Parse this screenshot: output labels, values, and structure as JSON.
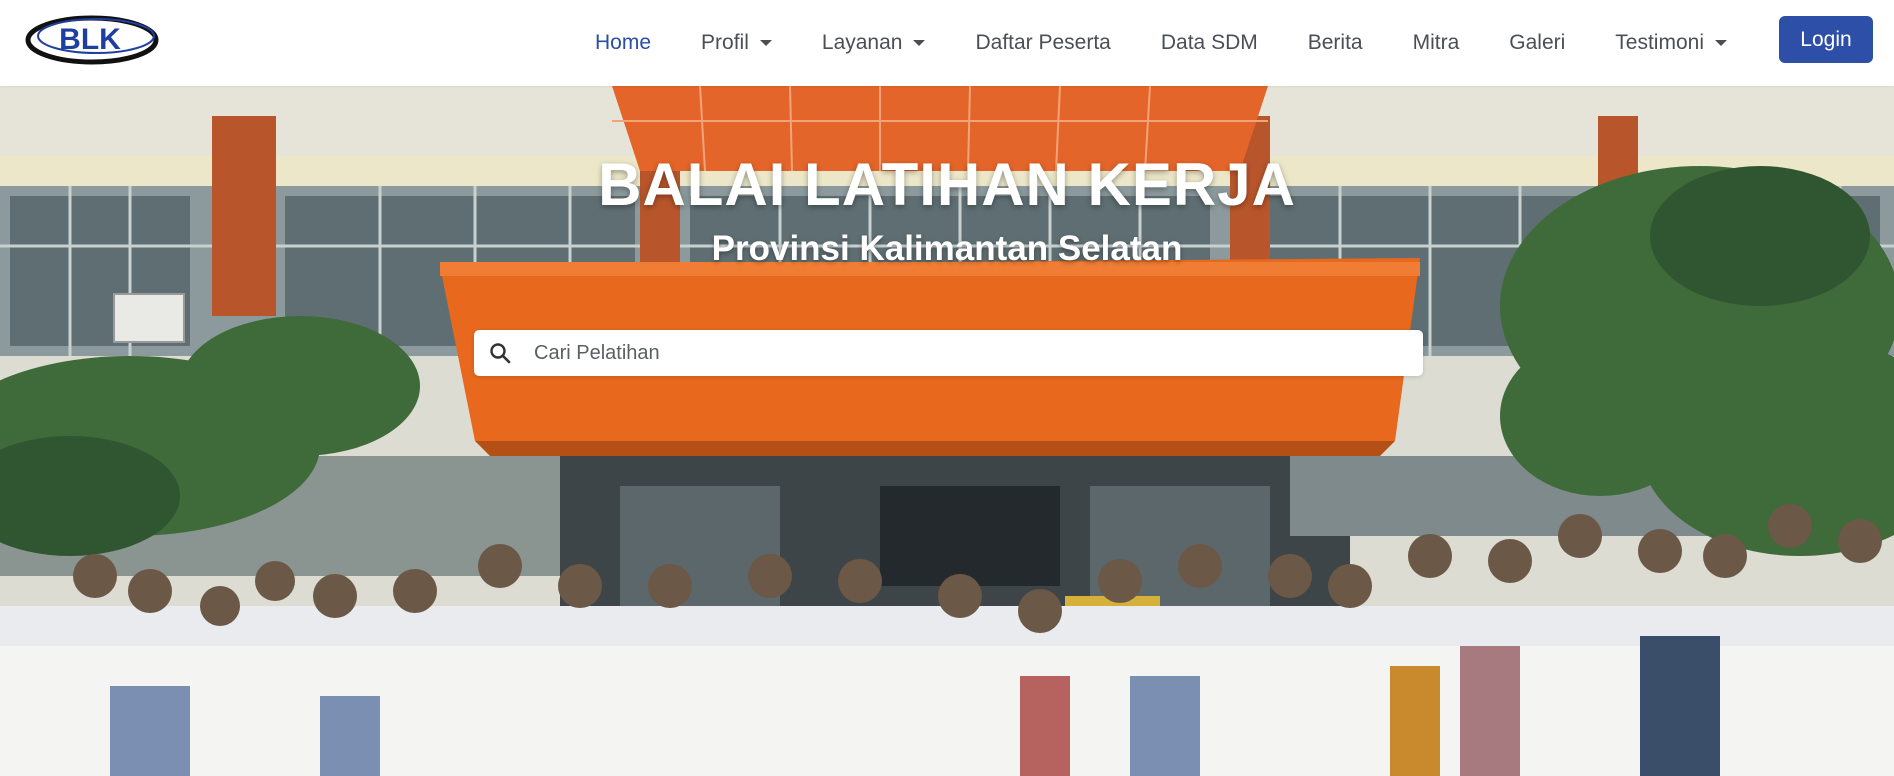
{
  "brand": {
    "logo_text": "BLK",
    "logo_icon": "blk-logo"
  },
  "nav": {
    "items": [
      {
        "label": "Home",
        "active": true,
        "dropdown": false
      },
      {
        "label": "Profil",
        "active": false,
        "dropdown": true
      },
      {
        "label": "Layanan",
        "active": false,
        "dropdown": true
      },
      {
        "label": "Daftar Peserta",
        "active": false,
        "dropdown": false
      },
      {
        "label": "Data SDM",
        "active": false,
        "dropdown": false
      },
      {
        "label": "Berita",
        "active": false,
        "dropdown": false
      },
      {
        "label": "Mitra",
        "active": false,
        "dropdown": false
      },
      {
        "label": "Galeri",
        "active": false,
        "dropdown": false
      },
      {
        "label": "Testimoni",
        "active": false,
        "dropdown": true
      }
    ],
    "login_label": "Login"
  },
  "hero": {
    "title": "BALAI LATIHAN KERJA",
    "subtitle": "Provinsi Kalimantan Selatan",
    "search": {
      "placeholder": "Cari Pelatihan",
      "value": "",
      "icon": "search-icon"
    },
    "image": "group-photo-in-front-of-building"
  },
  "colors": {
    "accent": "#2d4fa8",
    "active_nav": "#2a4ea3",
    "nav_text": "#4b4f55",
    "canopy_orange": "#e86a1c"
  }
}
